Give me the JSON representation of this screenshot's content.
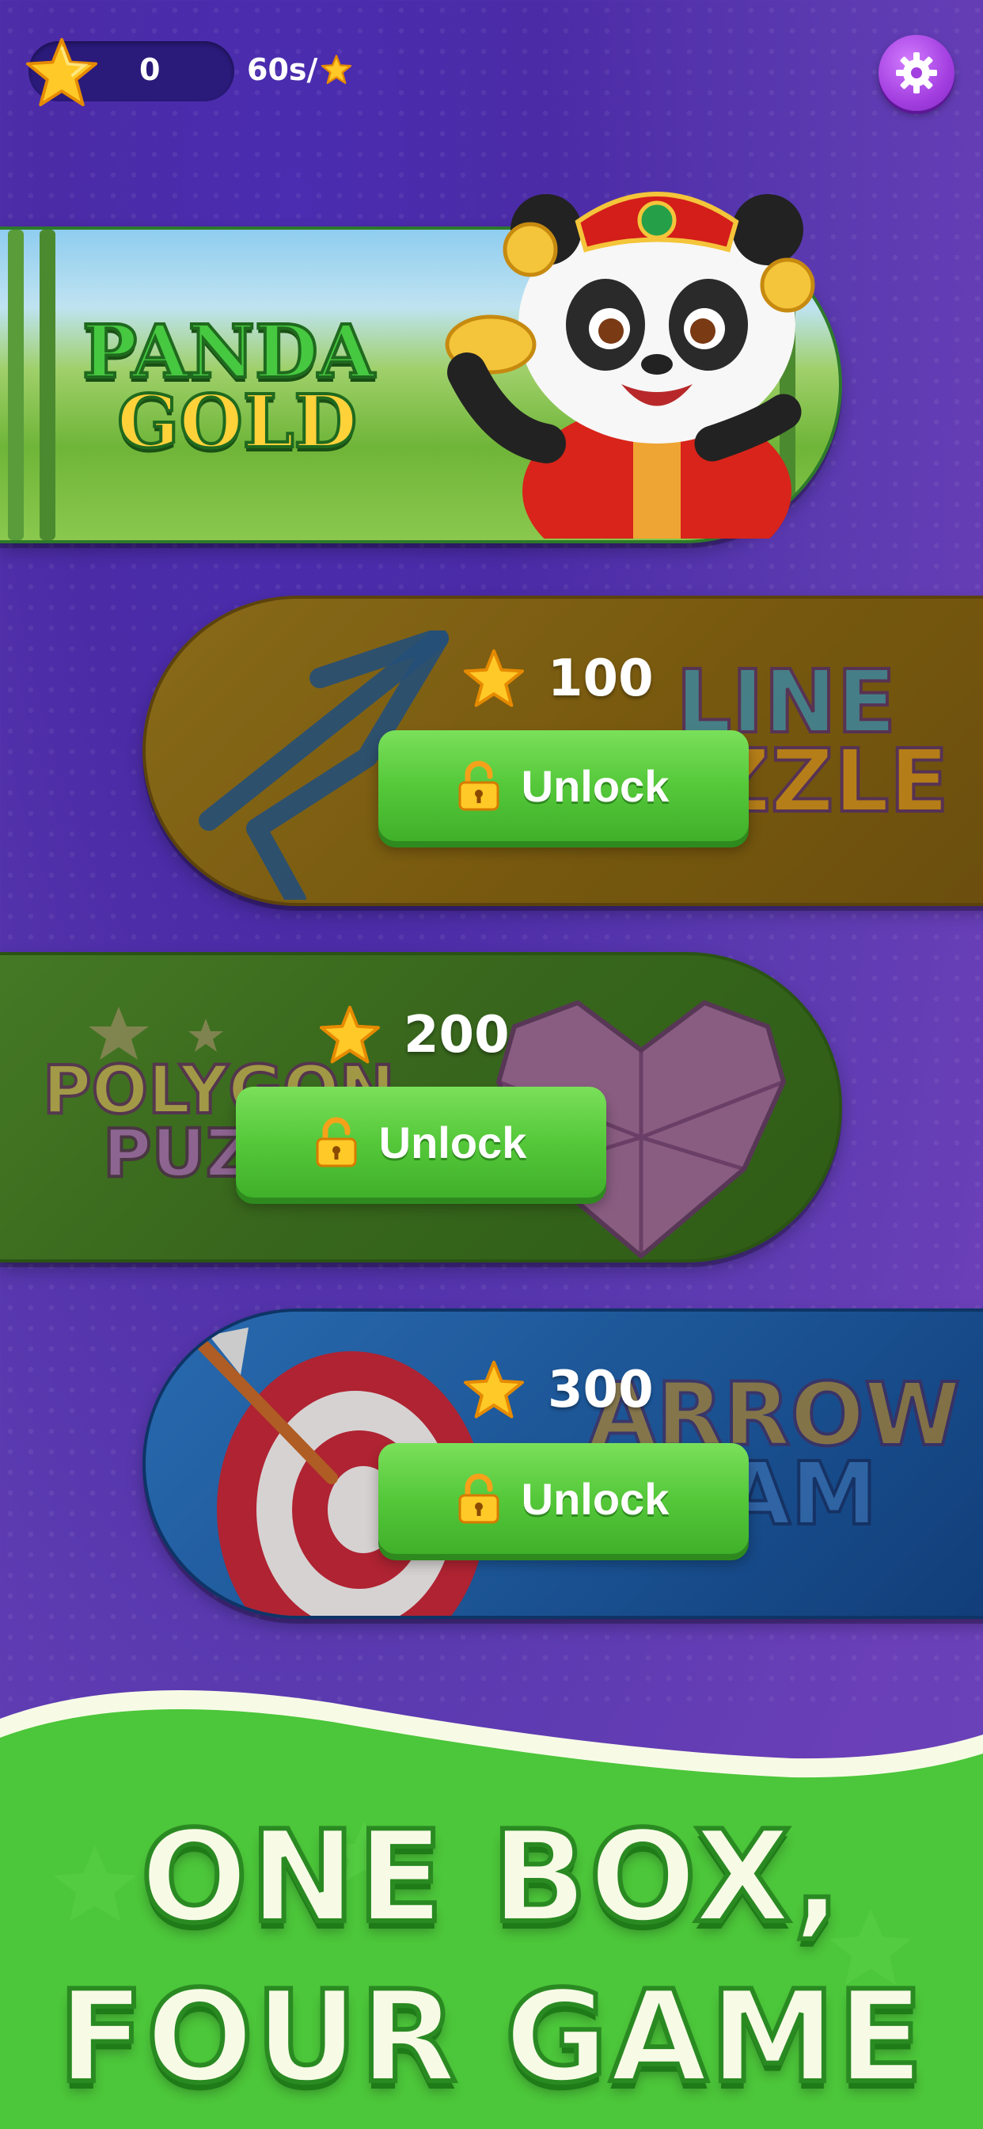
{
  "header": {
    "star_count": "0",
    "rate": "60s/",
    "settings_icon": "gear-icon",
    "star_icon": "star-icon"
  },
  "cards": [
    {
      "name": "panda-gold",
      "logo_line1": "PANDA",
      "logo_line2": "GOLD"
    },
    {
      "name": "line-puzzle",
      "cost": "100",
      "unlock_label": "Unlock",
      "logo_line1": "LINE",
      "logo_line2": "ZZLE"
    },
    {
      "name": "polygon-puzzle",
      "cost": "200",
      "unlock_label": "Unlock",
      "logo_line1": "POLYGON",
      "logo_line2": "PUZ"
    },
    {
      "name": "arrow-jam",
      "cost": "300",
      "unlock_label": "Unlock",
      "logo_line1": "ARROW",
      "logo_line2": "AM"
    }
  ],
  "banner": {
    "line1": "ONE BOX,",
    "line2": "FOUR GAME"
  },
  "colors": {
    "background": "#4b2ba6",
    "unlock_button": "#55c83a",
    "star": "#ffc928",
    "banner_green": "#4cc63a"
  }
}
